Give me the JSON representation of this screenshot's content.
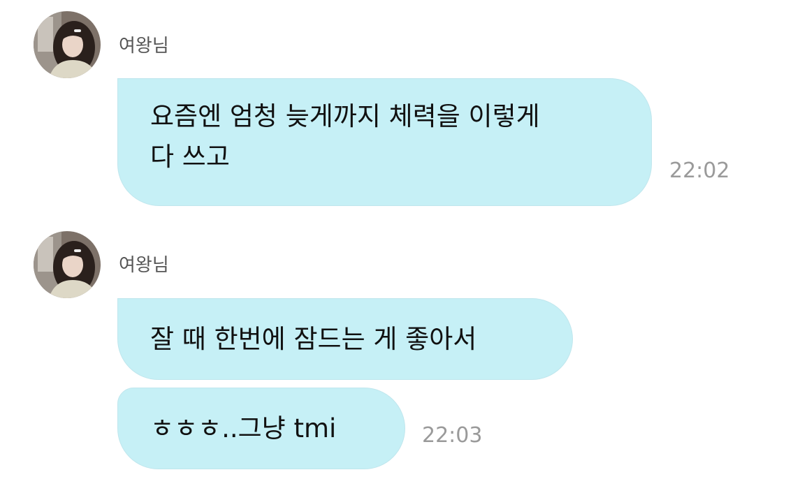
{
  "groups": [
    {
      "sender": "여왕님",
      "messages": [
        {
          "lines": [
            "요즘엔 엄청 늦게까지 체력을 이렇게",
            "다 쓰고"
          ],
          "time": "22:02"
        }
      ]
    },
    {
      "sender": "여왕님",
      "messages": [
        {
          "lines": [
            "잘 때 한번에 잠드는 게 좋아서"
          ],
          "time": ""
        },
        {
          "lines": [
            "ㅎㅎㅎ..그냥 tmi"
          ],
          "time": "22:03"
        }
      ]
    }
  ],
  "colors": {
    "bubble": "#c6f0f6",
    "bubble_border": "#bfe6ed",
    "text": "#111111",
    "name": "#555555",
    "time": "#9a9a9a"
  }
}
